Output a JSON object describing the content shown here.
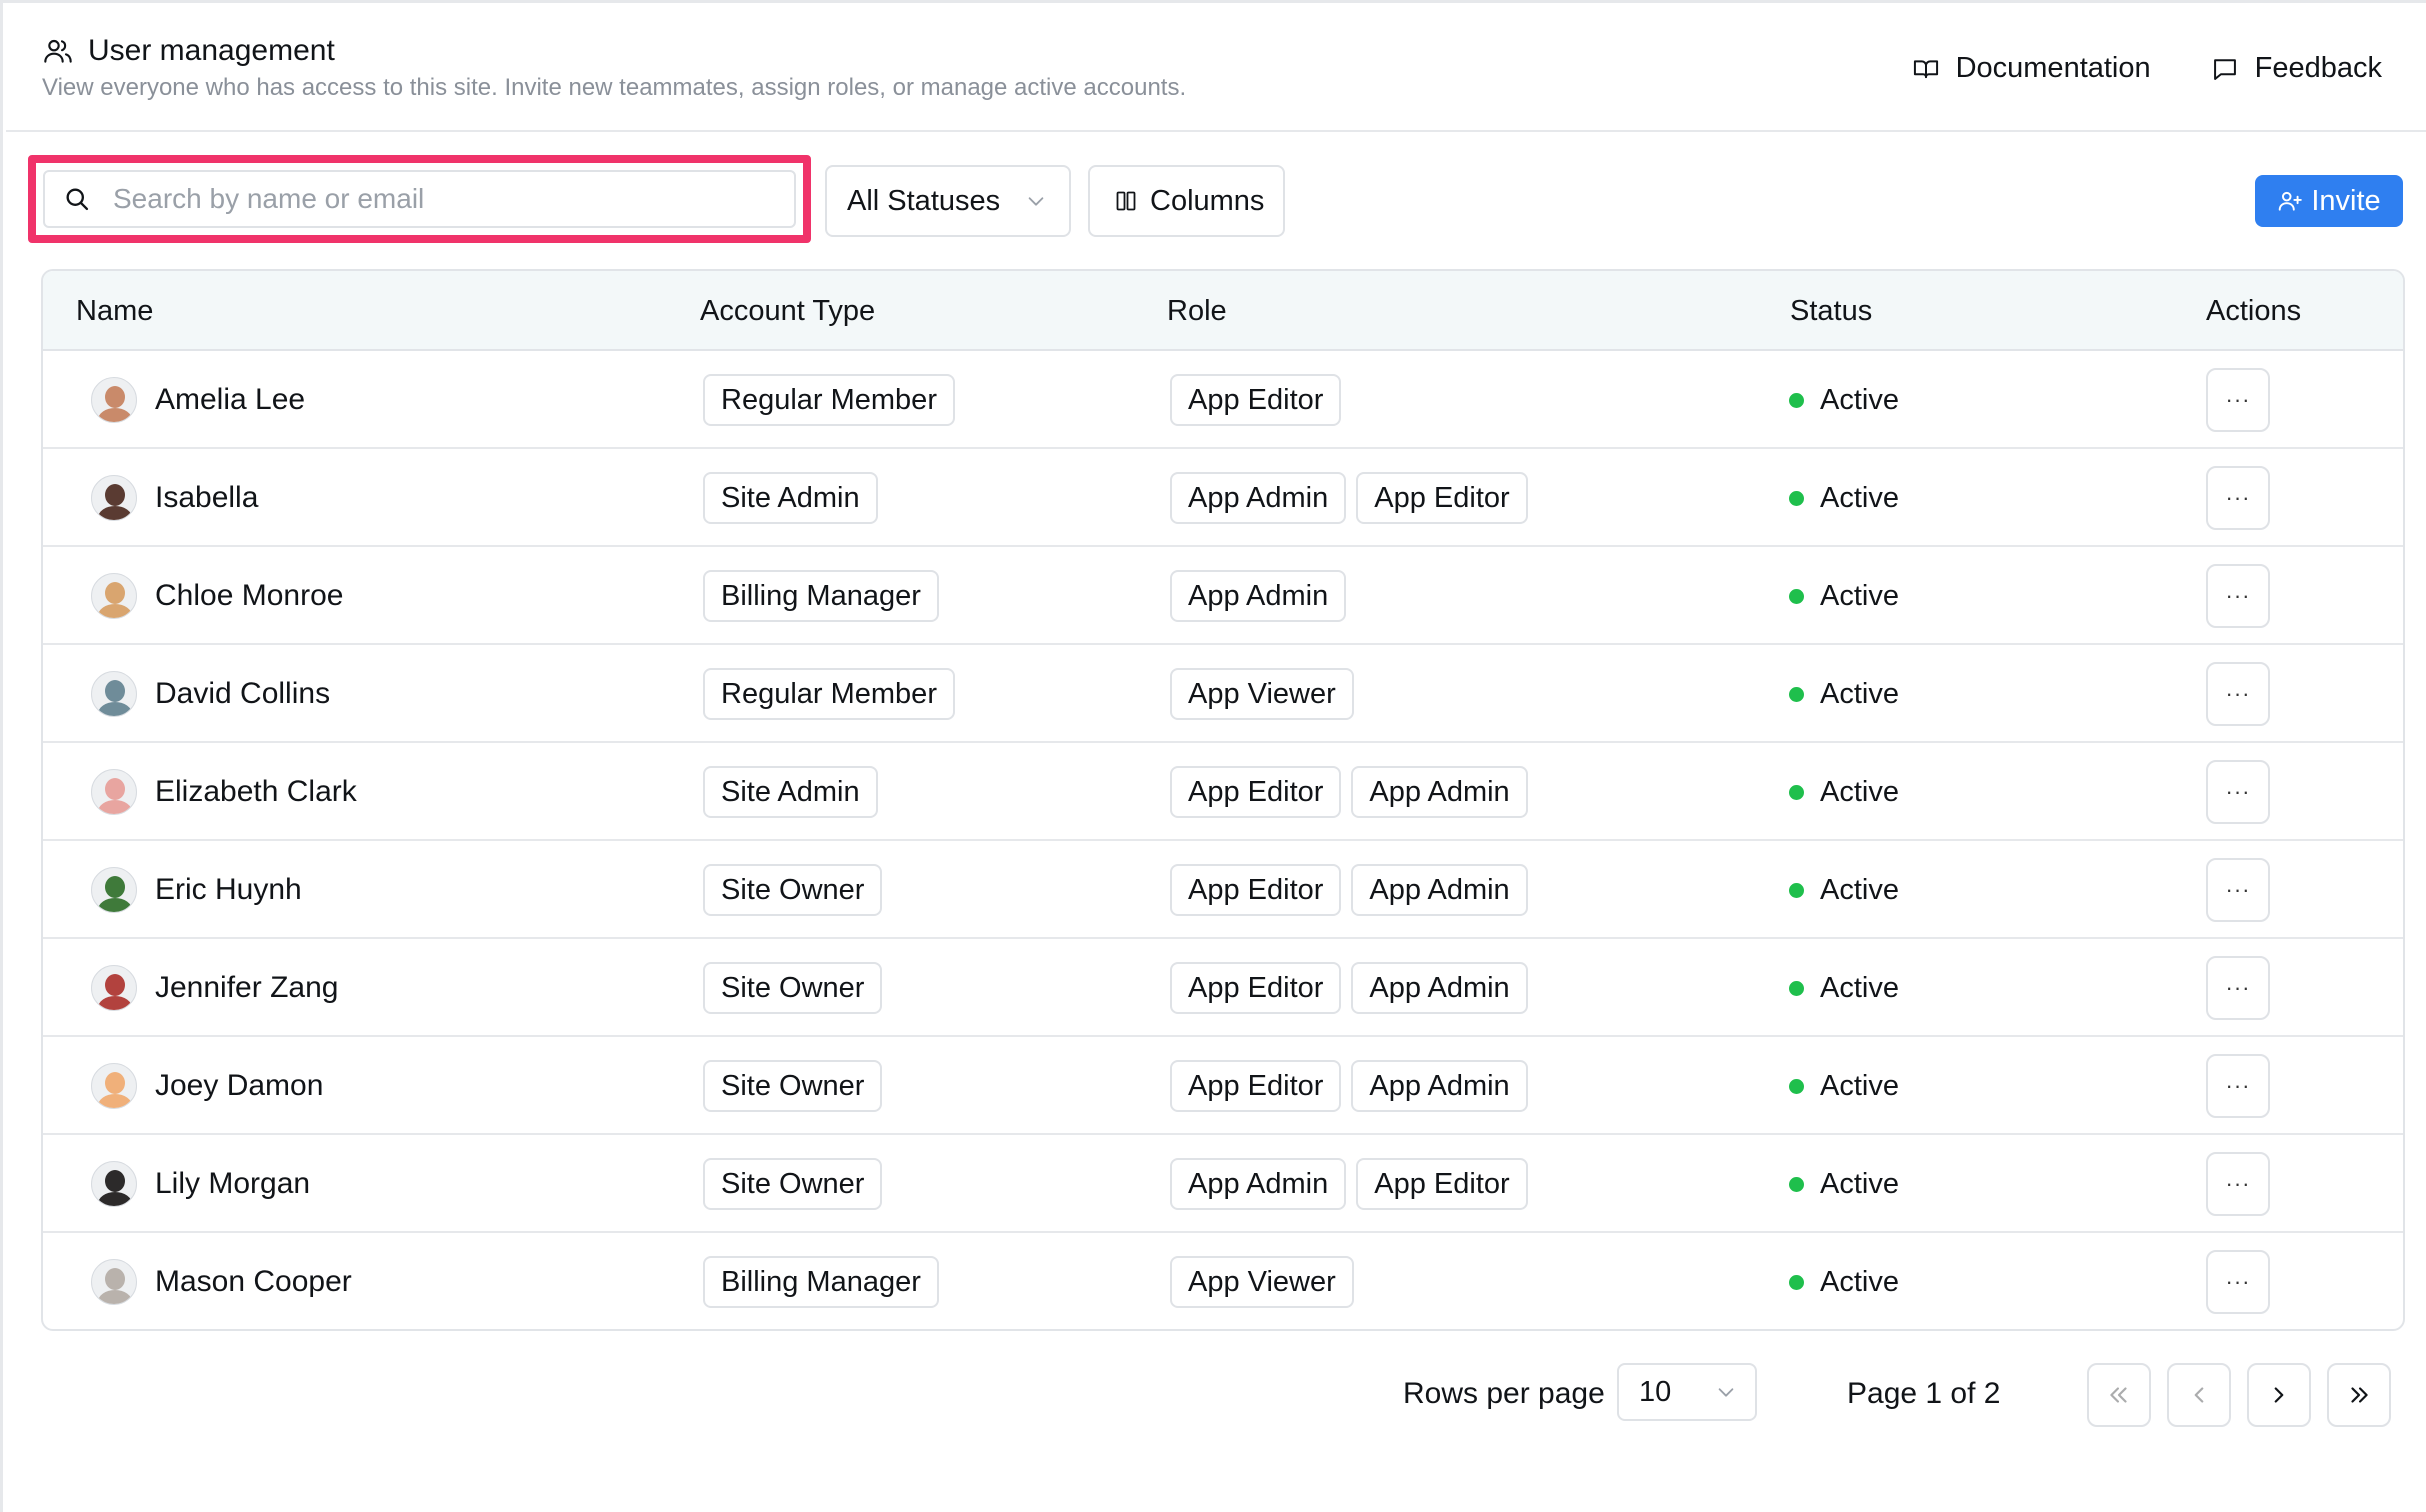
{
  "header": {
    "title": "User management",
    "subtitle": "View everyone who has access to this site. Invite new teammates, assign roles, or manage active accounts.",
    "documentation_label": "Documentation",
    "feedback_label": "Feedback"
  },
  "toolbar": {
    "search_placeholder": "Search by name or email",
    "status_filter": "All Statuses",
    "columns_label": "Columns",
    "invite_label": "Invite"
  },
  "table": {
    "headers": {
      "name": "Name",
      "account_type": "Account Type",
      "role": "Role",
      "status": "Status",
      "actions": "Actions"
    },
    "rows": [
      {
        "name": "Amelia Lee",
        "account_type": "Regular Member",
        "roles": [
          "App Editor"
        ],
        "status": "Active",
        "avatar_color": "#c98a6a"
      },
      {
        "name": "Isabella",
        "account_type": "Site Admin",
        "roles": [
          "App Admin",
          "App Editor"
        ],
        "status": "Active",
        "avatar_color": "#5a3b32"
      },
      {
        "name": "Chloe Monroe",
        "account_type": "Billing Manager",
        "roles": [
          "App Admin"
        ],
        "status": "Active",
        "avatar_color": "#d9a56f"
      },
      {
        "name": "David Collins",
        "account_type": "Regular Member",
        "roles": [
          "App Viewer"
        ],
        "status": "Active",
        "avatar_color": "#6f8c99"
      },
      {
        "name": "Elizabeth Clark",
        "account_type": "Site Admin",
        "roles": [
          "App Editor",
          "App Admin"
        ],
        "status": "Active",
        "avatar_color": "#e8a5a0"
      },
      {
        "name": "Eric Huynh",
        "account_type": "Site Owner",
        "roles": [
          "App Editor",
          "App Admin"
        ],
        "status": "Active",
        "avatar_color": "#3f7a3a"
      },
      {
        "name": "Jennifer Zang",
        "account_type": "Site Owner",
        "roles": [
          "App Editor",
          "App Admin"
        ],
        "status": "Active",
        "avatar_color": "#b2423e"
      },
      {
        "name": "Joey Damon",
        "account_type": "Site Owner",
        "roles": [
          "App Editor",
          "App Admin"
        ],
        "status": "Active",
        "avatar_color": "#f0b07a"
      },
      {
        "name": "Lily Morgan",
        "account_type": "Site Owner",
        "roles": [
          "App Admin",
          "App Editor"
        ],
        "status": "Active",
        "avatar_color": "#2c2a2a"
      },
      {
        "name": "Mason Cooper",
        "account_type": "Billing Manager",
        "roles": [
          "App Viewer"
        ],
        "status": "Active",
        "avatar_color": "#b9b2ac"
      }
    ],
    "actions_glyph": "···"
  },
  "pagination": {
    "rows_per_page_label": "Rows per page",
    "rows_per_page_value": "10",
    "page_info": "Page 1 of 2"
  },
  "colors": {
    "accent": "#2f7ff0",
    "highlight": "#f0336a",
    "status_active": "#1fbf4c",
    "header_bg": "#f3f8f9"
  }
}
